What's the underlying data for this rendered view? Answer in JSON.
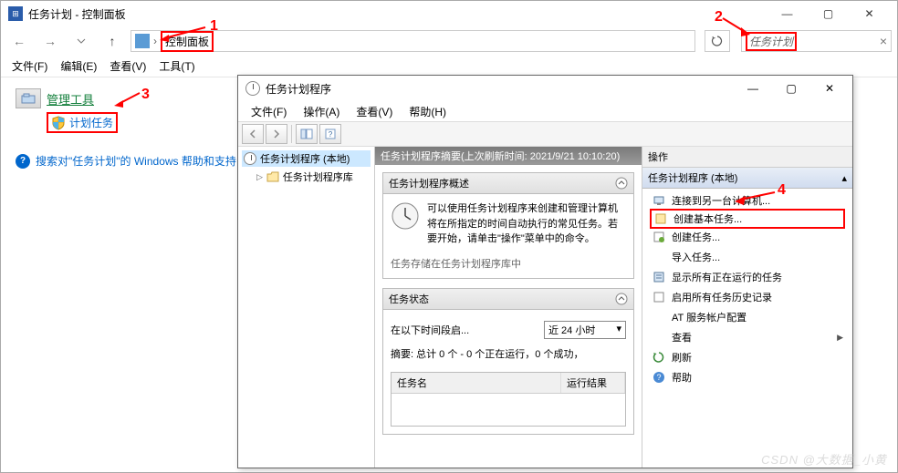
{
  "cp": {
    "title": "任务计划 - 控制面板",
    "addr_item": "控制面板",
    "search_placeholder": "任务计划",
    "menu": {
      "file": "文件(F)",
      "edit": "编辑(E)",
      "view": "查看(V)",
      "tools": "工具(T)"
    },
    "header_link": "管理工具",
    "sublink": "计划任务",
    "help_link": "搜索对\"任务计划\"的 Windows 帮助和支持"
  },
  "anno": {
    "n1": "1",
    "n2": "2",
    "n3": "3",
    "n4": "4"
  },
  "ts": {
    "title": "任务计划程序",
    "menu": {
      "file": "文件(F)",
      "action": "操作(A)",
      "view": "查看(V)",
      "help": "帮助(H)"
    },
    "tree": {
      "root": "任务计划程序 (本地)",
      "lib": "任务计划程序库"
    },
    "center_header": "任务计划程序摘要(上次刷新时间: 2021/9/21 10:10:20)",
    "overview": {
      "title": "任务计划程序概述",
      "text": "可以使用任务计划程序来创建和管理计算机将在所指定的时间自动执行的常见任务。若要开始，请单击\"操作\"菜单中的命令。",
      "footer": "任务存储在任务计划程序库中"
    },
    "status": {
      "title": "任务状态",
      "label": "在以下时间段启...",
      "select": "近 24 小时",
      "summary": "摘要: 总计 0 个 - 0 个正在运行，0 个成功，",
      "col1": "任务名",
      "col2": "运行结果"
    },
    "actions": {
      "title": "操作",
      "section": "任务计划程序 (本地)",
      "items": [
        "连接到另一台计算机...",
        "创建基本任务...",
        "创建任务...",
        "导入任务...",
        "显示所有正在运行的任务",
        "启用所有任务历史记录",
        "AT 服务帐户配置",
        "查看",
        "刷新",
        "帮助"
      ]
    }
  },
  "watermark": "CSDN @大数据_小黄"
}
